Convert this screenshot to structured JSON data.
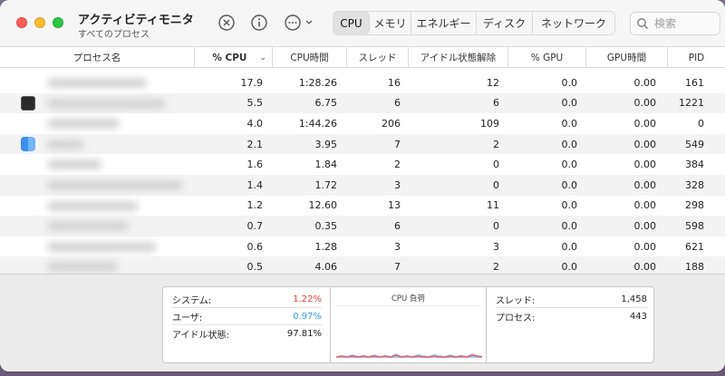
{
  "app": {
    "title": "アクティビティモニタ",
    "subtitle": "すべてのプロセス"
  },
  "colors": {
    "system": "#ff3b30",
    "user": "#2d9ff0"
  },
  "toolbar": {
    "stop_icon": "x-circle-icon",
    "info_icon": "info-icon",
    "more_icon": "ellipsis-circle-icon",
    "tabs": [
      {
        "label": "CPU",
        "active": true
      },
      {
        "label": "メモリ",
        "active": false
      },
      {
        "label": "エネルギー",
        "active": false
      },
      {
        "label": "ディスク",
        "active": false
      },
      {
        "label": "ネットワーク",
        "active": false
      }
    ],
    "search_placeholder": "検索"
  },
  "table": {
    "columns": [
      "プロセス名",
      "% CPU",
      "CPU時間",
      "スレッド",
      "アイドル状態解除",
      "% GPU",
      "GPU時間",
      "PID"
    ],
    "rows": [
      {
        "cpu": "17.9",
        "cpu_time": "1:28.26",
        "threads": "16",
        "idle_wakeups": "12",
        "gpu": "0.0",
        "gpu_time": "0.00",
        "pid": "161"
      },
      {
        "cpu": "5.5",
        "cpu_time": "6.75",
        "threads": "6",
        "idle_wakeups": "6",
        "gpu": "0.0",
        "gpu_time": "0.00",
        "pid": "1221"
      },
      {
        "cpu": "4.0",
        "cpu_time": "1:44.26",
        "threads": "206",
        "idle_wakeups": "109",
        "gpu": "0.0",
        "gpu_time": "0.00",
        "pid": "0"
      },
      {
        "cpu": "2.1",
        "cpu_time": "3.95",
        "threads": "7",
        "idle_wakeups": "2",
        "gpu": "0.0",
        "gpu_time": "0.00",
        "pid": "549"
      },
      {
        "cpu": "1.6",
        "cpu_time": "1.84",
        "threads": "2",
        "idle_wakeups": "0",
        "gpu": "0.0",
        "gpu_time": "0.00",
        "pid": "384"
      },
      {
        "cpu": "1.4",
        "cpu_time": "1.72",
        "threads": "3",
        "idle_wakeups": "0",
        "gpu": "0.0",
        "gpu_time": "0.00",
        "pid": "328"
      },
      {
        "cpu": "1.2",
        "cpu_time": "12.60",
        "threads": "13",
        "idle_wakeups": "11",
        "gpu": "0.0",
        "gpu_time": "0.00",
        "pid": "298"
      },
      {
        "cpu": "0.7",
        "cpu_time": "0.35",
        "threads": "6",
        "idle_wakeups": "0",
        "gpu": "0.0",
        "gpu_time": "0.00",
        "pid": "598"
      },
      {
        "cpu": "0.6",
        "cpu_time": "1.28",
        "threads": "3",
        "idle_wakeups": "3",
        "gpu": "0.0",
        "gpu_time": "0.00",
        "pid": "621"
      },
      {
        "cpu": "0.5",
        "cpu_time": "4.06",
        "threads": "7",
        "idle_wakeups": "2",
        "gpu": "0.0",
        "gpu_time": "0.00",
        "pid": "188"
      }
    ]
  },
  "footer": {
    "left": [
      {
        "label": "システム:",
        "value": "1.22%"
      },
      {
        "label": "ユーザ:",
        "value": "0.97%"
      },
      {
        "label": "アイドル状態:",
        "value": "97.81%"
      }
    ],
    "graph_title": "CPU 負荷",
    "right": [
      {
        "label": "スレッド:",
        "value": "1,458"
      },
      {
        "label": "プロセス:",
        "value": "443"
      }
    ]
  }
}
